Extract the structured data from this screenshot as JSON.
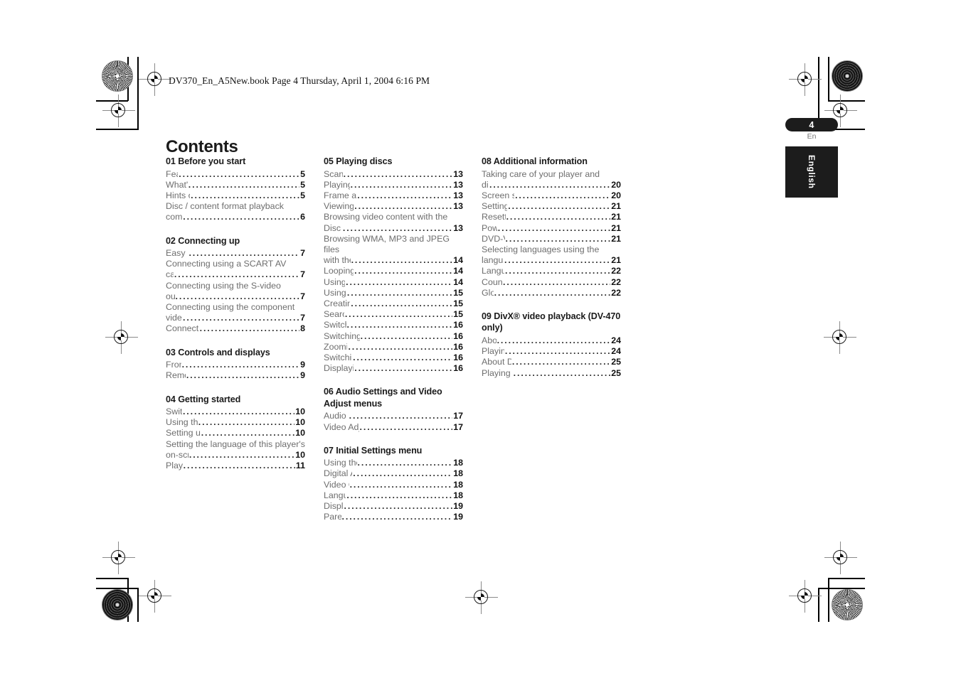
{
  "header": {
    "book_line": "DV370_En_A5New.book  Page 4  Thursday, April 1, 2004  6:16 PM"
  },
  "page_title": "Contents",
  "page_marker": {
    "number": "4",
    "lang_short": "En",
    "lang_tab": "English"
  },
  "toc": {
    "columns": [
      {
        "chapters": [
          {
            "title": "01 Before you start",
            "entries": [
              {
                "label": "Features",
                "page": "5"
              },
              {
                "label": "What's in the box",
                "page": "5"
              },
              {
                "label": "Hints on installation",
                "page": "5"
              },
              {
                "label": "Disc / content format playback",
                "page": ""
              },
              {
                "label": "compatibility",
                "page": "6"
              }
            ]
          },
          {
            "title": "02 Connecting up",
            "entries": [
              {
                "label": "Easy connections",
                "page": "7"
              },
              {
                "label": "Connecting using a SCART AV",
                "page": ""
              },
              {
                "label": "cable",
                "page": "7"
              },
              {
                "label": "Connecting using the S-video",
                "page": ""
              },
              {
                "label": "output",
                "page": "7"
              },
              {
                "label": "Connecting using the component",
                "page": ""
              },
              {
                "label": "video output",
                "page": "7"
              },
              {
                "label": "Connecting to an AV receiver",
                "page": "8"
              }
            ]
          },
          {
            "title": "03 Controls and displays",
            "entries": [
              {
                "label": "Front panel",
                "page": "9"
              },
              {
                "label": "Remote control",
                "page": "9"
              }
            ]
          },
          {
            "title": "04 Getting started",
            "entries": [
              {
                "label": "Switching on",
                "page": "10"
              },
              {
                "label": "Using the on-screen displays",
                "page": "10"
              },
              {
                "label": "Setting up the player for your TV",
                "page": "10"
              },
              {
                "label": "Setting the language of this player's",
                "page": ""
              },
              {
                "label": "on-screen displays",
                "page": "10"
              },
              {
                "label": "Playing discs",
                "page": "11"
              }
            ]
          }
        ]
      },
      {
        "chapters": [
          {
            "title": "05 Playing discs",
            "entries": [
              {
                "label": "Scanning discs",
                "page": "13"
              },
              {
                "label": "Playing in slow motion",
                "page": "13"
              },
              {
                "label": "Frame advance/frame reverse",
                "page": "13"
              },
              {
                "label": "Viewing a JPEG slideshow",
                "page": "13"
              },
              {
                "label": "Browsing video content with the",
                "page": ""
              },
              {
                "label": "Disc Navigator",
                "page": "13"
              },
              {
                "label": "Browsing WMA, MP3 and JPEG files",
                "page": ""
              },
              {
                "label": "with the Disc Navigator",
                "page": "14"
              },
              {
                "label": "Looping a section of a disc",
                "page": "14"
              },
              {
                "label": "Using repeat play",
                "page": "14"
              },
              {
                "label": "Using random play",
                "page": "15"
              },
              {
                "label": "Creating a program list",
                "page": "15"
              },
              {
                "label": "Searching a disc",
                "page": "15"
              },
              {
                "label": "Switching subtitles",
                "page": "16"
              },
              {
                "label": "Switching audio language/channel",
                "page": "16"
              },
              {
                "label": "Zooming the screen",
                "page": "16"
              },
              {
                "label": "Switching camera angles",
                "page": "16"
              },
              {
                "label": "Displaying disc information",
                "page": "16"
              }
            ]
          },
          {
            "title": "06 Audio Settings and Video Adjust menus",
            "entries": [
              {
                "label": "Audio Settings menu",
                "page": "17"
              },
              {
                "label": "Video Adjust menu (DV-470 only)",
                "page": "17"
              }
            ]
          },
          {
            "title": "07 Initial Settings menu",
            "entries": [
              {
                "label": "Using the Initial Settings menu",
                "page": "18"
              },
              {
                "label": "Digital Audio Out settings",
                "page": "18"
              },
              {
                "label": "Video Output settings",
                "page": "18"
              },
              {
                "label": "Language settings",
                "page": "18"
              },
              {
                "label": "Display settings",
                "page": "19"
              },
              {
                "label": "Parental Lock",
                "page": "19"
              }
            ]
          }
        ]
      },
      {
        "chapters": [
          {
            "title": "08 Additional information",
            "entries": [
              {
                "label": "Taking care of your player and",
                "page": ""
              },
              {
                "label": "discs",
                "page": "20"
              },
              {
                "label": "Screen sizes and disc formats",
                "page": "20"
              },
              {
                "label": "Setting the TV system",
                "page": "21"
              },
              {
                "label": "Resetting the player",
                "page": "21"
              },
              {
                "label": "Power reset",
                "page": "21"
              },
              {
                "label": "DVD-Video regions",
                "page": "21"
              },
              {
                "label": "Selecting languages using the",
                "page": ""
              },
              {
                "label": "language code list",
                "page": "21"
              },
              {
                "label": "Language code list",
                "page": "22"
              },
              {
                "label": "Country code list",
                "page": "22"
              },
              {
                "label": "Glossary",
                "page": "22"
              }
            ]
          },
          {
            "title": "09 DivX® video playback (DV-470 only)",
            "entries": [
              {
                "label": "About DivX",
                "page": "24"
              },
              {
                "label": "Playing DivX video",
                "page": "24"
              },
              {
                "label": "About DivX® VOD content",
                "page": "25"
              },
              {
                "label": "Playing DivX® VOD content",
                "page": "25"
              }
            ]
          }
        ]
      }
    ]
  }
}
